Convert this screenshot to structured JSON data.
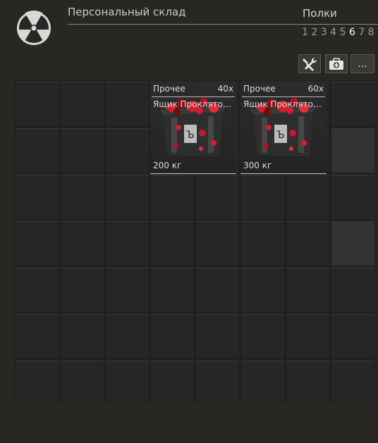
{
  "header": {
    "title": "Персональный склад",
    "shelves_label": "Полки",
    "shelves": [
      "1",
      "2",
      "3",
      "4",
      "5",
      "6",
      "7",
      "8"
    ],
    "active_shelf": "6"
  },
  "toolbar": {
    "buttons": [
      {
        "icon": "wrench-screwdriver-icon"
      },
      {
        "icon": "medkit-icon"
      },
      {
        "label": "..."
      }
    ]
  },
  "items": [
    {
      "category": "Прочее",
      "quantity": "40x",
      "name": "Ящик Проклятого...",
      "weight": "200 кг"
    },
    {
      "category": "Прочее",
      "quantity": "60x",
      "name": "Ящик Проклятого...",
      "weight": "300 кг"
    }
  ],
  "colors": {
    "background": "#282724",
    "cell": "#262626",
    "accent_red": "#d61e2a"
  }
}
